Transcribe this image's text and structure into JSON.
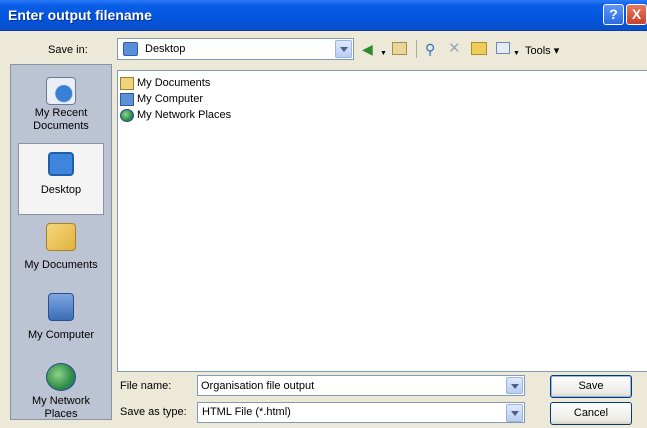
{
  "window": {
    "title": "Enter output filename",
    "help_label": "?",
    "close_label": "X"
  },
  "savein": {
    "label": "Save in:",
    "value": "Desktop"
  },
  "toolbar": {
    "tools_label": "Tools",
    "icons": [
      "back-icon",
      "up-folder-icon",
      "search-web-icon",
      "delete-icon",
      "new-folder-icon",
      "views-icon"
    ]
  },
  "places": [
    {
      "label_line1": "My Recent",
      "label_line2": "Documents",
      "icon": "recent-documents-icon"
    },
    {
      "label_line1": "Desktop",
      "label_line2": "",
      "icon": "desktop-icon"
    },
    {
      "label_line1": "My Documents",
      "label_line2": "",
      "icon": "my-documents-icon"
    },
    {
      "label_line1": "My Computer",
      "label_line2": "",
      "icon": "my-computer-icon"
    },
    {
      "label_line1": "My Network",
      "label_line2": "Places",
      "icon": "network-places-icon"
    }
  ],
  "files": [
    {
      "label": "My Documents",
      "icon": "my-documents-icon"
    },
    {
      "label": "My Computer",
      "icon": "my-computer-icon"
    },
    {
      "label": "My Network Places",
      "icon": "network-places-icon"
    }
  ],
  "bottom": {
    "filename_label": "File name:",
    "filename_value": "Organisation file output",
    "filetype_label": "Save as type:",
    "filetype_value": "HTML File (*.html)",
    "save_label": "Save",
    "cancel_label": "Cancel"
  },
  "colors": {
    "titlebar": "#0355de",
    "places_bg": "#bcc3d3",
    "dialog_bg": "#ece9d8"
  }
}
